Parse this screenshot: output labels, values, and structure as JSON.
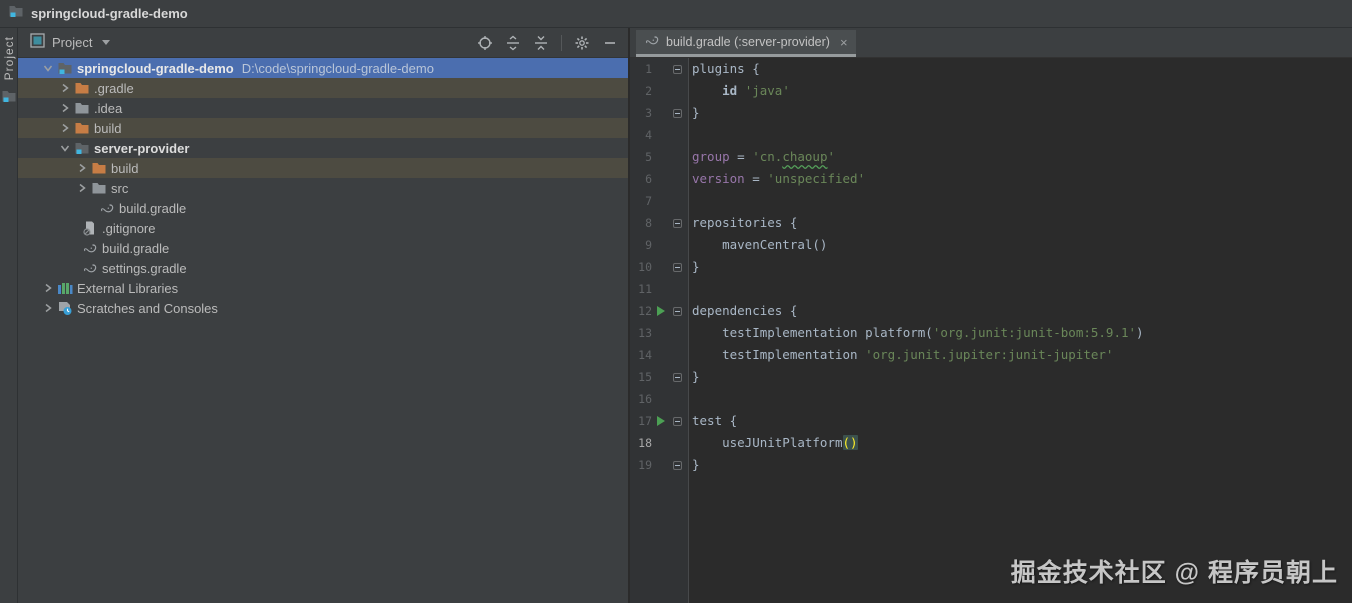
{
  "app": {
    "title": "springcloud-gradle-demo"
  },
  "left_stripe": {
    "tool_window_label": "Project"
  },
  "project_panel": {
    "header": {
      "title": "Project",
      "toolbar_icons": [
        "locate",
        "expand-all",
        "collapse-all",
        "separator",
        "settings",
        "hide"
      ]
    },
    "tree": [
      {
        "label": "springcloud-gradle-demo",
        "path": "D:\\code\\springcloud-gradle-demo",
        "icon": "project",
        "chevron": "expanded",
        "bold": true,
        "highlight": "selected",
        "indent": 0
      },
      {
        "label": ".gradle",
        "icon": "folder-orange",
        "chevron": "collapsed",
        "highlight": "olive",
        "indent": 1
      },
      {
        "label": ".idea",
        "icon": "folder-gray",
        "chevron": "collapsed",
        "indent": 1
      },
      {
        "label": "build",
        "icon": "folder-orange",
        "chevron": "collapsed",
        "highlight": "olive",
        "indent": 1
      },
      {
        "label": "server-provider",
        "icon": "module",
        "chevron": "expanded",
        "bold": true,
        "indent": 1
      },
      {
        "label": "build",
        "icon": "folder-orange",
        "chevron": "collapsed",
        "highlight": "olive",
        "indent": 2
      },
      {
        "label": "src",
        "icon": "folder-gray",
        "chevron": "collapsed",
        "indent": 2
      },
      {
        "label": "build.gradle",
        "icon": "gradle",
        "indent": 2,
        "file": true
      },
      {
        "label": ".gitignore",
        "icon": "gitignore",
        "indent": 1,
        "file": true
      },
      {
        "label": "build.gradle",
        "icon": "gradle",
        "indent": 1,
        "file": true
      },
      {
        "label": "settings.gradle",
        "icon": "gradle",
        "indent": 1,
        "file": true
      },
      {
        "label": "External Libraries",
        "icon": "libraries",
        "chevron": "collapsed",
        "indent": 0
      },
      {
        "label": "Scratches and Consoles",
        "icon": "scratches",
        "chevron": "collapsed",
        "indent": 0
      }
    ]
  },
  "editor": {
    "tab": {
      "title": "build.gradle (:server-provider)",
      "icon": "gradle",
      "close": "×"
    },
    "code": {
      "lines": [
        {
          "n": 1,
          "fold": "start",
          "tokens": [
            [
              "plugins {",
              "plain"
            ]
          ]
        },
        {
          "n": 2,
          "tokens": [
            [
              "    ",
              "plain"
            ],
            [
              "id",
              "bold"
            ],
            [
              " ",
              "plain"
            ],
            [
              "'java'",
              "string"
            ]
          ]
        },
        {
          "n": 3,
          "fold": "end",
          "tokens": [
            [
              "}",
              "plain"
            ]
          ]
        },
        {
          "n": 4,
          "tokens": []
        },
        {
          "n": 5,
          "tokens": [
            [
              "group",
              "field"
            ],
            [
              " = ",
              "plain"
            ],
            [
              "'cn.",
              "string"
            ],
            [
              "chaoup",
              "squig"
            ],
            [
              "'",
              "string"
            ]
          ]
        },
        {
          "n": 6,
          "tokens": [
            [
              "version",
              "field"
            ],
            [
              " = ",
              "plain"
            ],
            [
              "'unspecified'",
              "string"
            ]
          ]
        },
        {
          "n": 7,
          "tokens": []
        },
        {
          "n": 8,
          "fold": "start",
          "tokens": [
            [
              "repositories {",
              "plain"
            ]
          ]
        },
        {
          "n": 9,
          "tokens": [
            [
              "    mavenCentral()",
              "plain"
            ]
          ]
        },
        {
          "n": 10,
          "fold": "end",
          "tokens": [
            [
              "}",
              "plain"
            ]
          ]
        },
        {
          "n": 11,
          "tokens": []
        },
        {
          "n": 12,
          "run": true,
          "fold": "start",
          "tokens": [
            [
              "dependencies {",
              "plain"
            ]
          ]
        },
        {
          "n": 13,
          "tokens": [
            [
              "    testImplementation platform(",
              "plain"
            ],
            [
              "'org.junit:junit-bom:5.9.1'",
              "string"
            ],
            [
              ")",
              "plain"
            ]
          ]
        },
        {
          "n": 14,
          "tokens": [
            [
              "    testImplementation ",
              "plain"
            ],
            [
              "'org.junit.jupiter:junit-jupiter'",
              "string"
            ]
          ]
        },
        {
          "n": 15,
          "fold": "end",
          "tokens": [
            [
              "}",
              "plain"
            ]
          ]
        },
        {
          "n": 16,
          "tokens": []
        },
        {
          "n": 17,
          "run": true,
          "fold": "start",
          "tokens": [
            [
              "test {",
              "plain"
            ]
          ]
        },
        {
          "n": 18,
          "current": true,
          "tokens": [
            [
              "    useJUnitPlatform",
              "plain"
            ],
            [
              "()",
              "brace"
            ]
          ]
        },
        {
          "n": 19,
          "fold": "end",
          "tokens": [
            [
              "}",
              "plain"
            ]
          ]
        }
      ]
    }
  },
  "watermark": {
    "text": "掘金技术社区 @ 程序员朝上"
  },
  "colors": {
    "selection_blue": "#4B6EAF",
    "excluded_olive": "#4D4B41",
    "panel_bg": "#3C3F41",
    "editor_bg": "#2B2B2B",
    "gutter_bg": "#313335",
    "string_green": "#6A8759",
    "field_purple": "#9876AA",
    "default_text": "#A9B7C6",
    "folder_orange": "#C77D45",
    "run_green": "#4CA054",
    "brace_match_fg": "#FFEF28",
    "brace_match_bg": "#3B514D"
  }
}
